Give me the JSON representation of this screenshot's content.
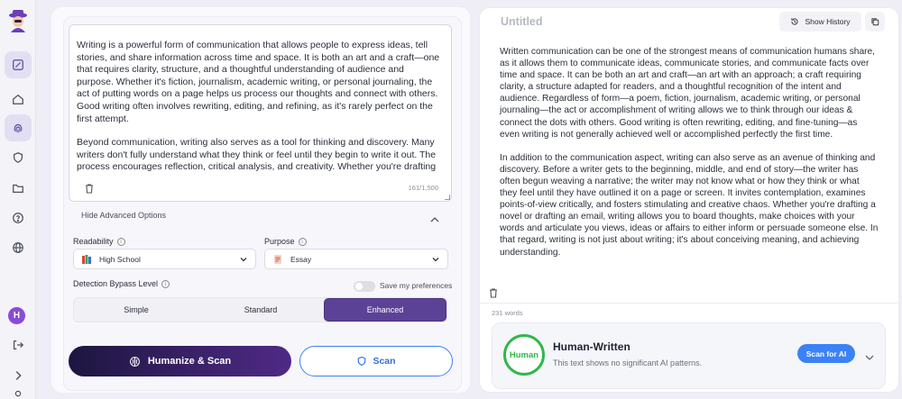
{
  "sidebar": {
    "avatar_initial": "H"
  },
  "input": {
    "paragraphs": [
      "Writing is a powerful form of communication that allows people to express ideas, tell stories, and share information across time and space. It is both an art and a craft—one that requires clarity, structure, and a thoughtful understanding of audience and purpose. Whether it's fiction, journalism, academic writing, or personal journaling, the act of putting words on a page helps us process our thoughts and connect with others. Good writing often involves rewriting, editing, and refining, as it's rarely perfect on the first attempt.",
      "Beyond communication, writing also serves as a tool for thinking and discovery. Many writers don't fully understand what they think or feel until they begin to write it out. The process encourages reflection, critical analysis, and creativity. Whether you're drafting a novel or composing an email, writing invites you to organize your thoughts, make"
    ],
    "counter": "161/1,500"
  },
  "advanced": {
    "toggle_label": "Hide Advanced Options",
    "readability_label": "Readability",
    "readability_value": "High School",
    "purpose_label": "Purpose",
    "purpose_value": "Essay",
    "bypass_label": "Detection Bypass Level",
    "save_pref_label": "Save my preferences",
    "levels": [
      "Simple",
      "Standard",
      "Enhanced"
    ],
    "active_level": "Enhanced"
  },
  "actions": {
    "humanize_label": "Humanize & Scan",
    "scan_label": "Scan"
  },
  "output": {
    "title": "Untitled",
    "history_label": "Show History",
    "paragraphs": [
      "Written communication can be one of the strongest means of communication humans share, as it allows them to communicate ideas, communicate stories, and communicate facts over time and space. It can be both an art and craft—an art with an approach; a craft requiring clarity, a structure adapted for readers, and a thoughtful recognition of the intent and audience. Regardless of form—a poem, fiction, journalism, academic writing, or personal journaling—the act or accomplishment of writing allows we to think through our ideas & connect the dots with others. Good writing is often rewriting, editing, and fine-tuning—as even writing is not generally achieved well or accomplished perfectly the first time.",
      "In addition to the communication aspect, writing can also serve as an avenue of thinking and discovery. Before a writer gets to the beginning, middle, and end of story—the writer has often begun weaving a narrative; the writer may not know what or how they think or what they feel until they have outlined it on a page or screen. It invites contemplation, examines points-of-view critically, and fosters stimulating and creative chaos. Whether you're drafting a novel or drafting an email, writing allows you to board thoughts, make choices with your words and articulate you views, ideas or affairs to either inform or persuade someone else. In that regard, writing is not just about writing; it's about conceiving meaning, and achieving understanding."
    ],
    "word_count": "231 words"
  },
  "result": {
    "badge": "Human",
    "title": "Human-Written",
    "description": "This text shows no significant AI patterns.",
    "scan_ai_label": "Scan for AI"
  },
  "colors": {
    "accent_purple": "#5c4296",
    "scan_blue": "#3b82f6",
    "human_green": "#2fb84a"
  }
}
